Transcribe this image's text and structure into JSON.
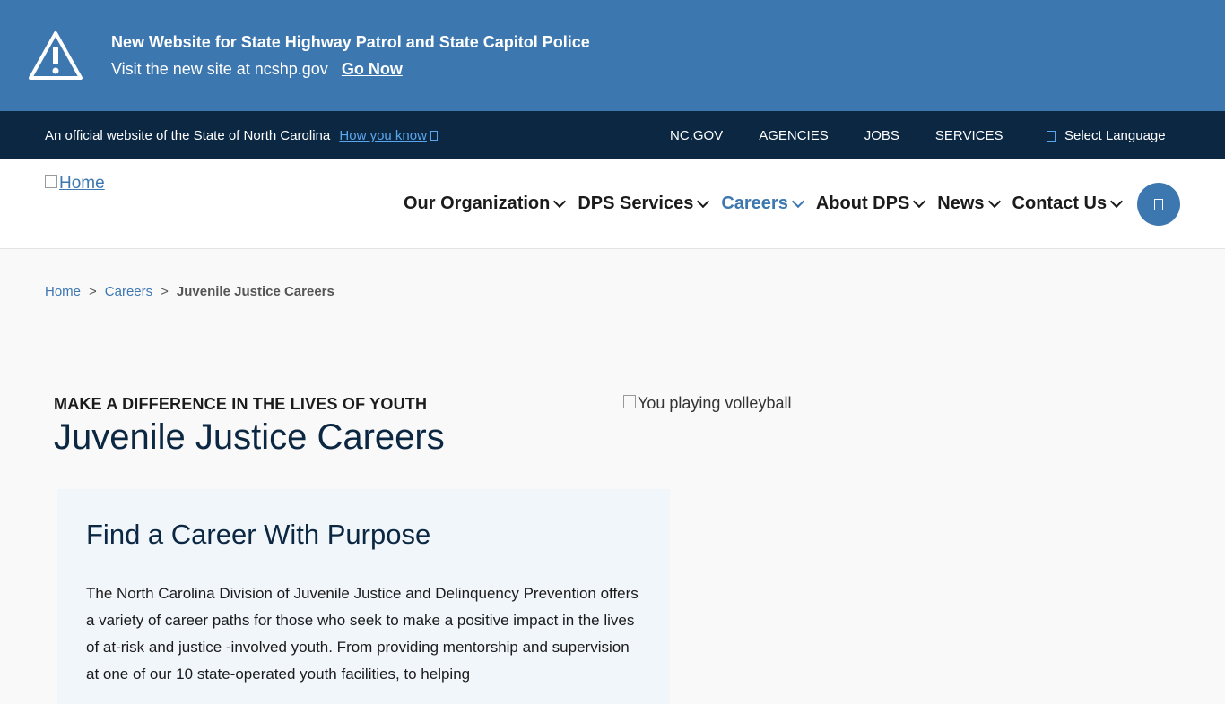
{
  "alert": {
    "icon": "warning-triangle-icon",
    "title": "New Website for State Highway Patrol and State Capitol Police",
    "text": "Visit the new site at ncshp.gov",
    "link_label": "Go Now"
  },
  "official_bar": {
    "text": "An official website of the State of North Carolina",
    "how_link": "How you know",
    "nav": [
      "NC.GOV",
      "AGENCIES",
      "JOBS",
      "SERVICES"
    ],
    "language": "Select Language"
  },
  "header": {
    "logo_alt": "Home",
    "nav": [
      {
        "label": "Our Organization",
        "active": false
      },
      {
        "label": "DPS Services",
        "active": false
      },
      {
        "label": "Careers",
        "active": true
      },
      {
        "label": "About DPS",
        "active": false
      },
      {
        "label": "News",
        "active": false
      },
      {
        "label": "Contact Us",
        "active": false
      }
    ]
  },
  "breadcrumb": {
    "items": [
      "Home",
      "Careers"
    ],
    "separator": ">",
    "current": "Juvenile Justice Careers"
  },
  "hero": {
    "eyebrow": "MAKE A DIFFERENCE IN THE LIVES OF YOUTH",
    "title": "Juvenile Justice Careers",
    "image_alt": "You playing volleyball"
  },
  "card": {
    "heading": "Find a Career With Purpose",
    "body": "The North Carolina Division of Juvenile Justice and Delinquency Prevention offers a variety of career paths for those who seek to make a positive impact in the lives of at-risk and justice -involved youth. From providing mentorship and supervision at one of our 10 state-operated youth facilities, to helping"
  },
  "colors": {
    "alert_bg": "#3d77b0",
    "official_bg": "#0b2742",
    "accent": "#3d77b0",
    "card_bg": "#f1f6fb"
  }
}
